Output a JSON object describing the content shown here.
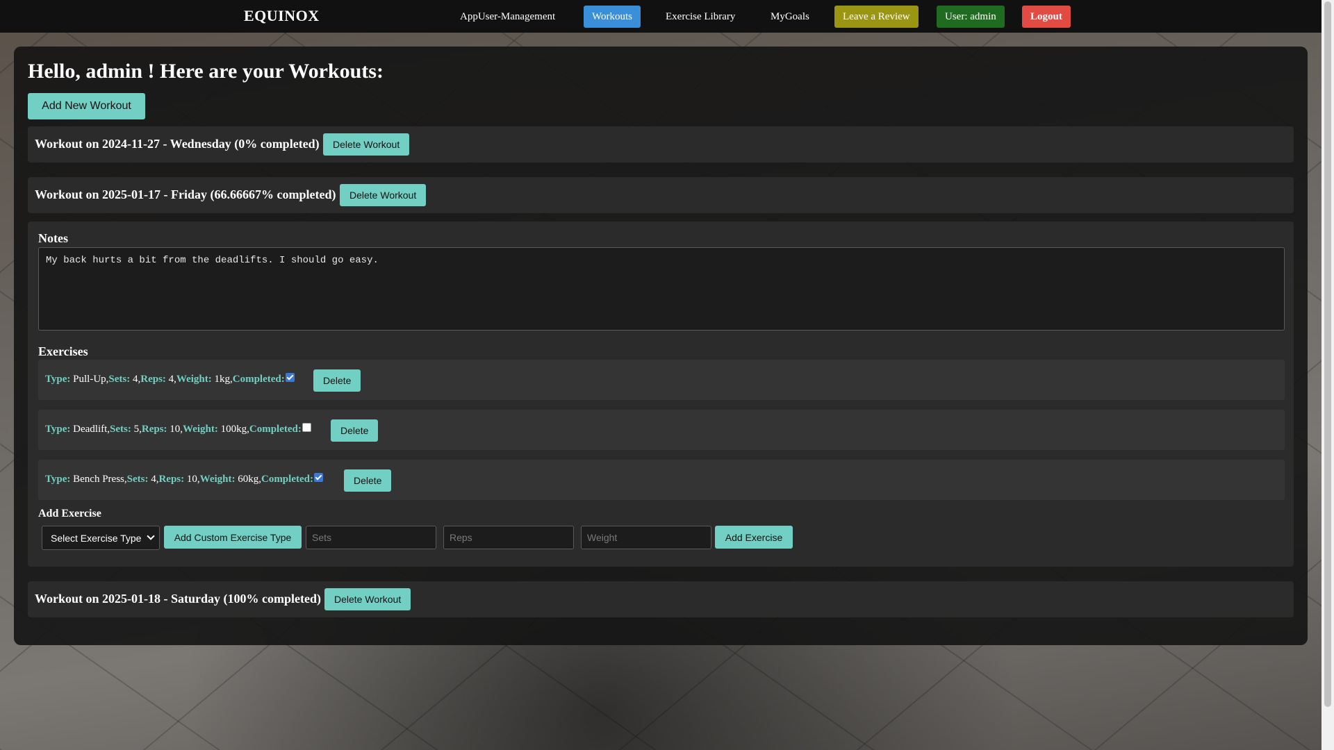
{
  "nav": {
    "brand": "EQUINOX",
    "items": [
      {
        "label": "AppUser-Management"
      },
      {
        "label": "Workouts"
      },
      {
        "label": "Exercise Library"
      },
      {
        "label": "MyGoals"
      },
      {
        "label": "Leave a Review"
      },
      {
        "label": "User: admin"
      },
      {
        "label": "Logout"
      }
    ]
  },
  "page": {
    "title": "Hello, admin ! Here are your Workouts:",
    "add_workout_label": "Add New Workout"
  },
  "workouts": [
    {
      "header": "Workout on 2024-11-27 - Wednesday (0% completed)",
      "delete_label": "Delete Workout"
    },
    {
      "header": "Workout on 2025-01-17 - Friday (66.66667% completed)",
      "delete_label": "Delete Workout"
    },
    {
      "header": "Workout on 2025-01-18 - Saturday (100% completed)",
      "delete_label": "Delete Workout"
    }
  ],
  "detail": {
    "notes_label": "Notes",
    "notes_value": "My back hurts a bit from the deadlifts. I should go easy.",
    "exercises_label": "Exercises",
    "keys": {
      "type": "Type:",
      "sets": "Sets:",
      "reps": "Reps:",
      "weight": "Weight:",
      "completed": "Completed:"
    },
    "exercises": [
      {
        "type": "Pull-Up",
        "sets": "4",
        "reps": "4",
        "weight": "1kg",
        "completed": true,
        "delete_label": "Delete"
      },
      {
        "type": "Deadlift",
        "sets": "5",
        "reps": "10",
        "weight": "100kg",
        "completed": false,
        "delete_label": "Delete"
      },
      {
        "type": "Bench Press",
        "sets": "4",
        "reps": "10",
        "weight": "60kg",
        "completed": true,
        "delete_label": "Delete"
      }
    ],
    "add_exercise": {
      "label": "Add Exercise",
      "select_value": "Select Exercise Type",
      "custom_type_label": "Add Custom Exercise Type",
      "sets_placeholder": "Sets",
      "reps_placeholder": "Reps",
      "weight_placeholder": "Weight",
      "submit_label": "Add Exercise"
    }
  },
  "colors": {
    "accent": "#72cfc3",
    "nav_active": "#3b8ed8",
    "review": "#9b9514",
    "user": "#1f6b1f",
    "logout": "#e24a44"
  }
}
